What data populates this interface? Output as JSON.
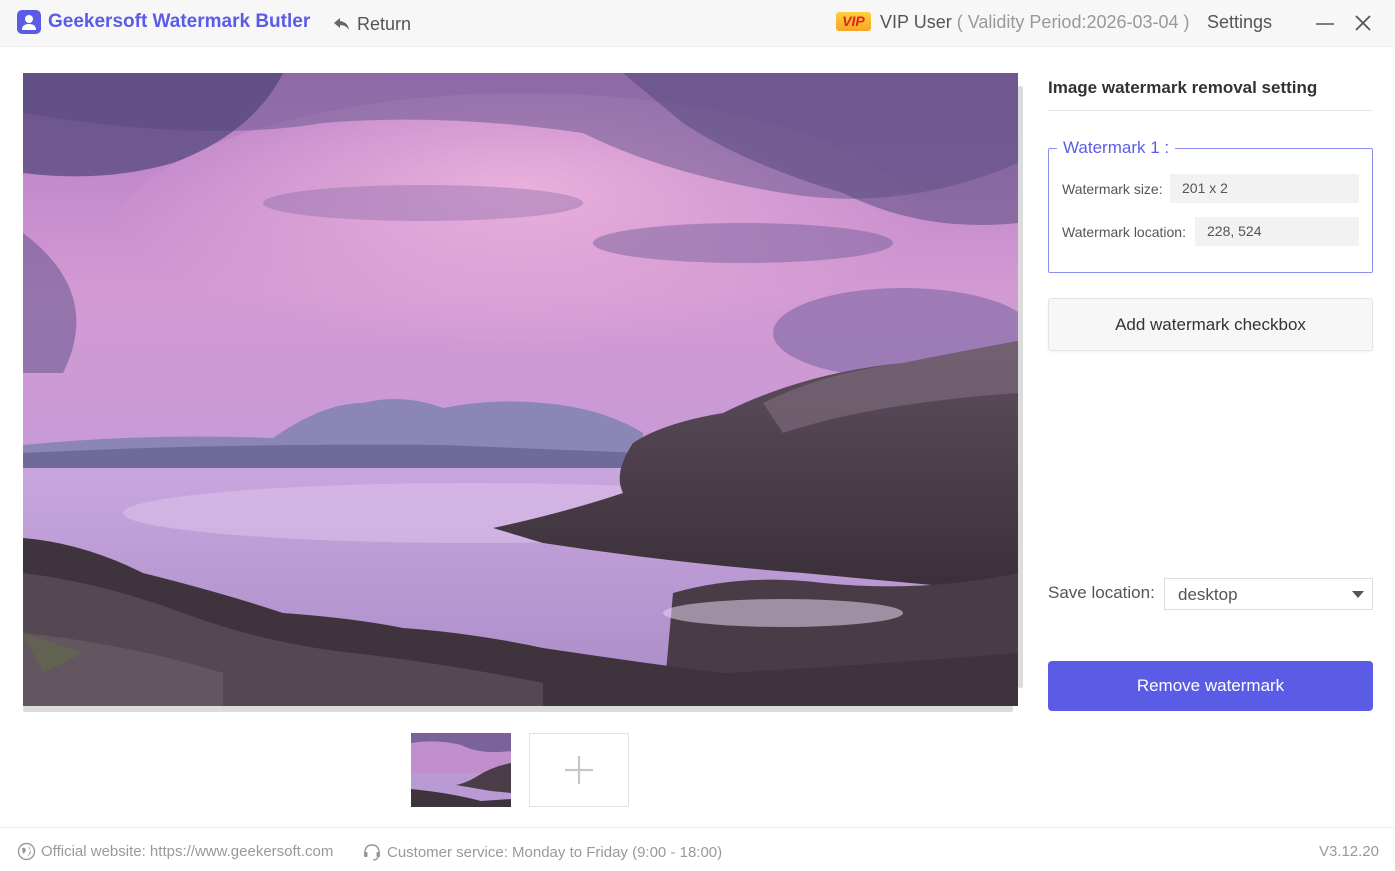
{
  "titlebar": {
    "app_title": "Geekersoft Watermark Butler",
    "return_label": "Return",
    "vip_badge": "VIP",
    "vip_user": "VIP User",
    "validity": "Validity Period:2026-03-04",
    "settings_label": "Settings"
  },
  "panel": {
    "title": "Image watermark removal setting",
    "watermark": {
      "legend": "Watermark 1 :",
      "size_label": "Watermark size:",
      "size_value": "201 x 2",
      "location_label": "Watermark location:",
      "location_value": "228, 524"
    },
    "add_checkbox_label": "Add watermark checkbox",
    "save_location_label": "Save location:",
    "save_location_value": "desktop",
    "remove_label": "Remove watermark"
  },
  "footer": {
    "website": "Official website: https://www.geekersoft.com",
    "service": "Customer service: Monday to Friday (9:00 - 18:00)",
    "version": "V3.12.20"
  },
  "colors": {
    "accent": "#5b5ce6",
    "vip_gold": "#f5a623",
    "vip_red": "#e0231c"
  },
  "icons": [
    "user-logo-icon",
    "return-arrow-icon",
    "minimize-icon",
    "close-icon",
    "plus-icon",
    "globe-icon",
    "headset-icon",
    "caret-down-icon"
  ]
}
